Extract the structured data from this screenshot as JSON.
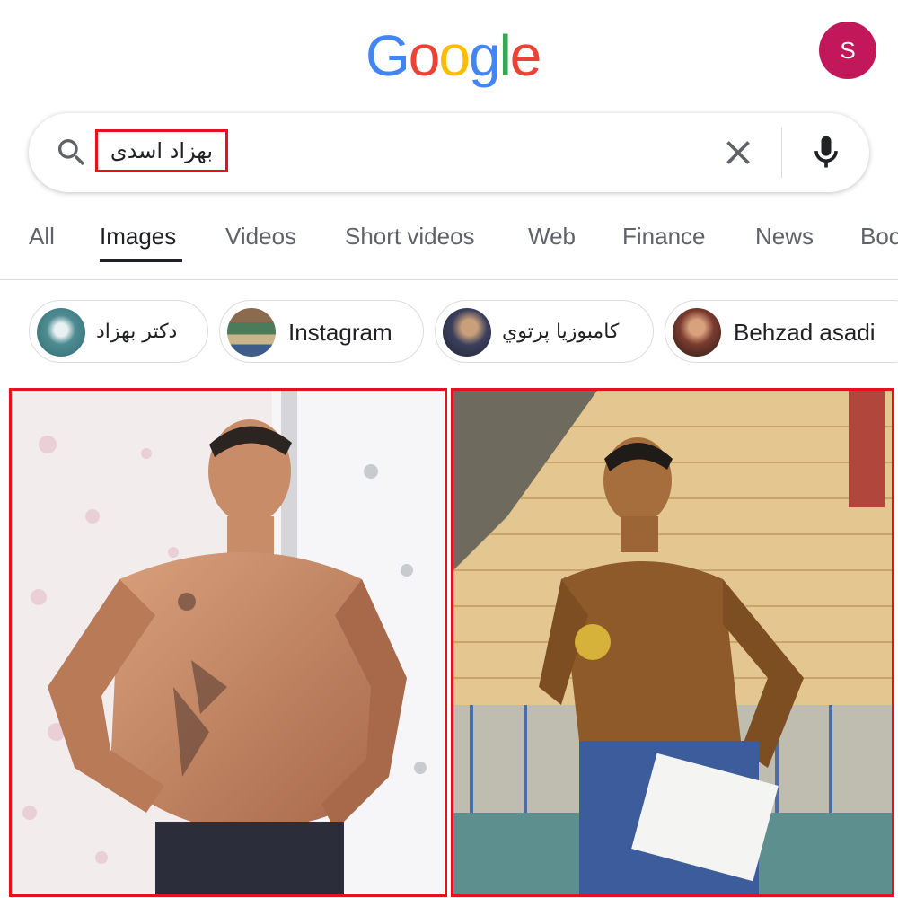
{
  "logo": {
    "letters": [
      "G",
      "o",
      "o",
      "g",
      "l",
      "e"
    ],
    "colors": [
      "#4285f4",
      "#ea4335",
      "#fbbc05",
      "#4285f4",
      "#34a853",
      "#ea4335"
    ]
  },
  "account": {
    "initial": "S",
    "color": "#c2185b"
  },
  "search": {
    "query": "بهزاد اسدی"
  },
  "tabs": [
    "All",
    "Images",
    "Videos",
    "Short videos",
    "Web",
    "Finance",
    "News",
    "Boo"
  ],
  "active_tab": "Images",
  "chips": [
    "دکتر بهزاد",
    "Instagram",
    "کامبوزیا پرتوي",
    "Behzad asadi"
  ],
  "highlight_color": "#e8101f",
  "results": [
    {
      "description": "shirtless bodybuilder posing by window"
    },
    {
      "description": "bodybuilder holding gold medal and certificate in gym"
    }
  ]
}
